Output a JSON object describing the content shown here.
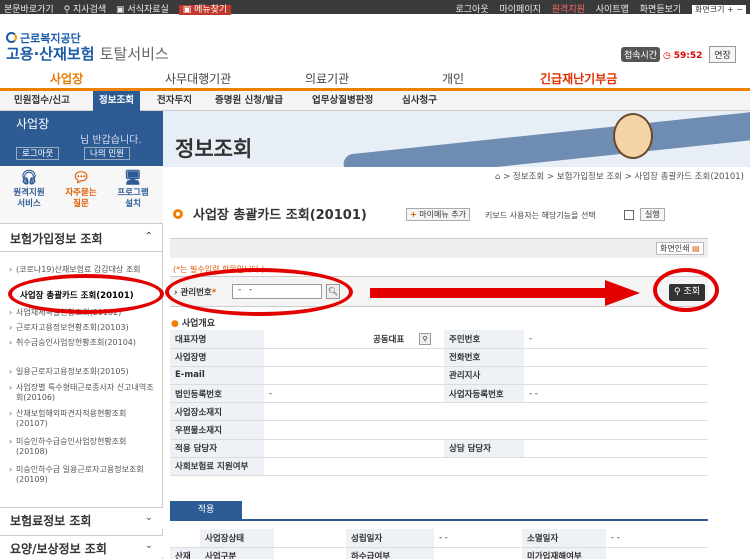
{
  "topbar": {
    "links_left": [
      "본문바로가기",
      "지사검색",
      "서식자료실",
      "메뉴찾기"
    ],
    "links_right": [
      "로그아웃",
      "마이페이지",
      "원격지원",
      "사이트맵",
      "화면듣보기",
      "화면크기"
    ]
  },
  "header": {
    "logo_sub": "근로복지공단",
    "logo_main": "고용·산재보험",
    "logo_tail": "토탈서비스",
    "session_label": "접속시간",
    "session_time": "59:52",
    "extend_label": "연장"
  },
  "gnb": [
    "사업장",
    "사무대행기관",
    "의료기관",
    "개인",
    "긴급재난기부금"
  ],
  "subnav": [
    "민원접수/신고",
    "정보조회",
    "전자두지",
    "증명원 신청/발급",
    "업무상질병판정",
    "심사청구"
  ],
  "sidebar": {
    "user_title": "사업장",
    "greeting": "님 반갑습니다.",
    "logout": "로그아웃",
    "myinfo": "나의 민원",
    "quick": [
      "원격지원\n서비스",
      "자주묻는\n질문",
      "프로그램\n설치"
    ],
    "section_title": "보험가입정보 조회",
    "items": [
      "(코로나19)산재보험료 감감대상 조회",
      "사업장 총괄카드 조회(20101)",
      "사업재세목별현황조회(20102)",
      "근로자고용정보현황조회(20103)",
      "취수금승인사업장현황조회(20104)",
      "일용근로자고용정보조회(20105)",
      "사업장별 특수형태근로종사자 신고내역조회(20106)",
      "산재보험해외파견자적용현황조회(20107)",
      "미승인하수급승인사업장현황조회(20108)",
      "미승인하수급 일용근로자고용정보조회(20109)"
    ],
    "foot1": "보험료정보 조회",
    "foot2": "요양/보상정보 조회"
  },
  "banner_title": "정보조회",
  "breadcrumb": "⌂ > 정보조회 > 보험가입정보 조회 > 사업장 총괄카드 조회(20101)",
  "page_title": "사업장 총괄카드 조회(20101)",
  "mymenu_label": "마이메뉴 추가",
  "keyboard_text": "키보드 사용자는 해당기능을 선택",
  "keyboard_btn": "실행",
  "print_label": "화면인쇄",
  "required_note": "(*는 필수입력 항목입니다.)",
  "mgmt_label": "관리번호",
  "mgmt_value": "-   -",
  "query_label": "조회",
  "section_label": "사업개요",
  "info_rows": [
    {
      "l1": "대표자명",
      "v1": "",
      "l2": "공동대표",
      "v2": "",
      "l3": "주민번호",
      "v3": "-"
    },
    {
      "l1": "사업장명",
      "v1": "",
      "l3": "전화번호",
      "v3": ""
    },
    {
      "l1": "E-mail",
      "v1": "",
      "l3": "관리지사",
      "v3": ""
    },
    {
      "l1": "법인등록번호",
      "v1": "-",
      "l3": "사업자등록번호",
      "v3": "-  -"
    },
    {
      "l1": "사업장소재지",
      "v1": ""
    },
    {
      "l1": "우편물소재지",
      "v1": ""
    },
    {
      "l1": "적용 담당자",
      "v1": "",
      "l3": "상담 담당자",
      "v3": ""
    },
    {
      "l1": "사회보험료 지원여부",
      "v1": ""
    }
  ],
  "tab_label": "적용",
  "t2": {
    "r1": [
      "사업장상태",
      "",
      "성립일자",
      "-  -",
      "소멸일자",
      "-  -"
    ],
    "r2_left": "산재",
    "r2": [
      "사업구분",
      "",
      "하수급여부",
      "",
      "미가입재해여부",
      ""
    ]
  },
  "colors": {
    "primary": "#2d5b94",
    "accent": "#f08000",
    "annotation": "#e30000"
  }
}
